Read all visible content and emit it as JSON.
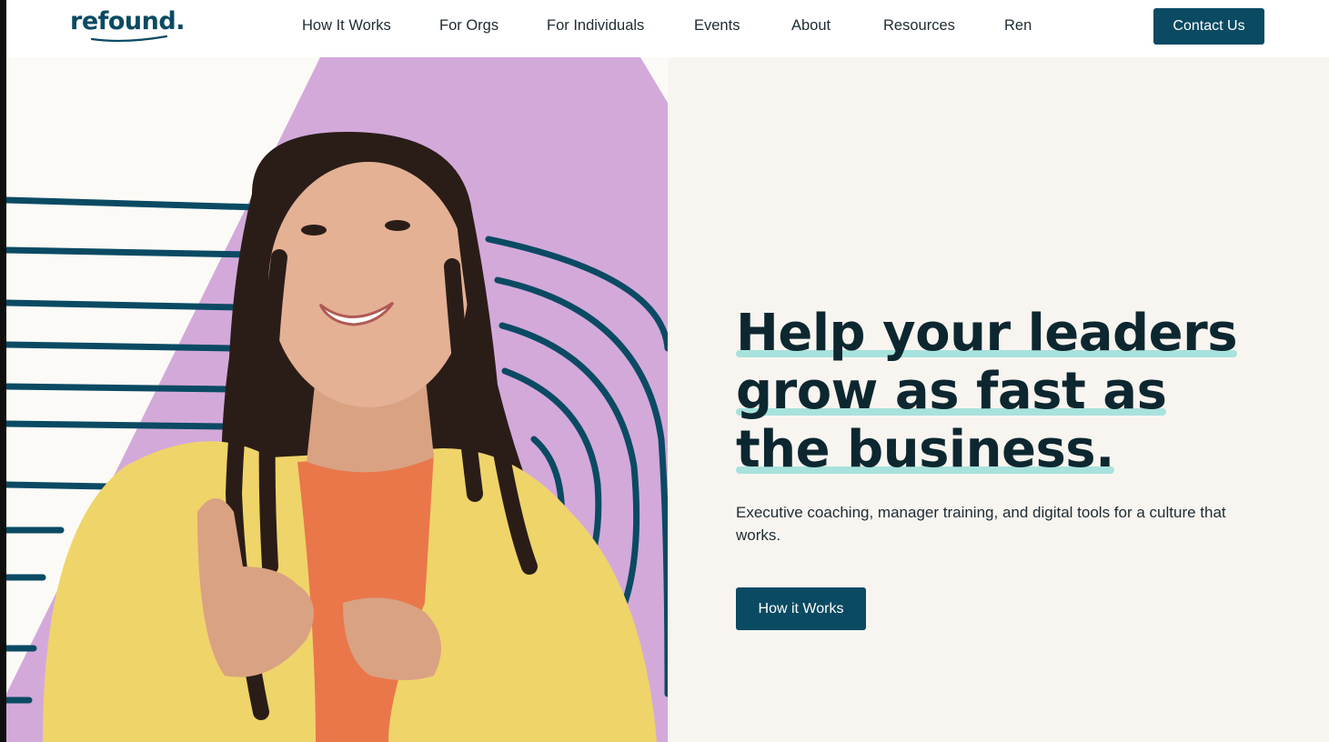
{
  "brand": {
    "logo_text": "refound.",
    "accent": "#0b4a63",
    "highlight": "#a8e2dc",
    "purple": "#d3a9da"
  },
  "nav": {
    "items": [
      {
        "label": "How It Works"
      },
      {
        "label": "For Orgs"
      },
      {
        "label": "For Individuals"
      },
      {
        "label": "Events"
      },
      {
        "label": "About"
      },
      {
        "label": "Resources"
      },
      {
        "label": "Ren"
      }
    ],
    "cta_label": "Contact Us"
  },
  "hero": {
    "headline_lines": [
      "Help your leaders",
      "grow as fast as",
      "the business."
    ],
    "subtitle": "Executive coaching, manager training, and digital tools for a culture that works.",
    "button_label": "How it Works",
    "image_alt": "Smiling woman with braids wearing a yellow jacket"
  }
}
